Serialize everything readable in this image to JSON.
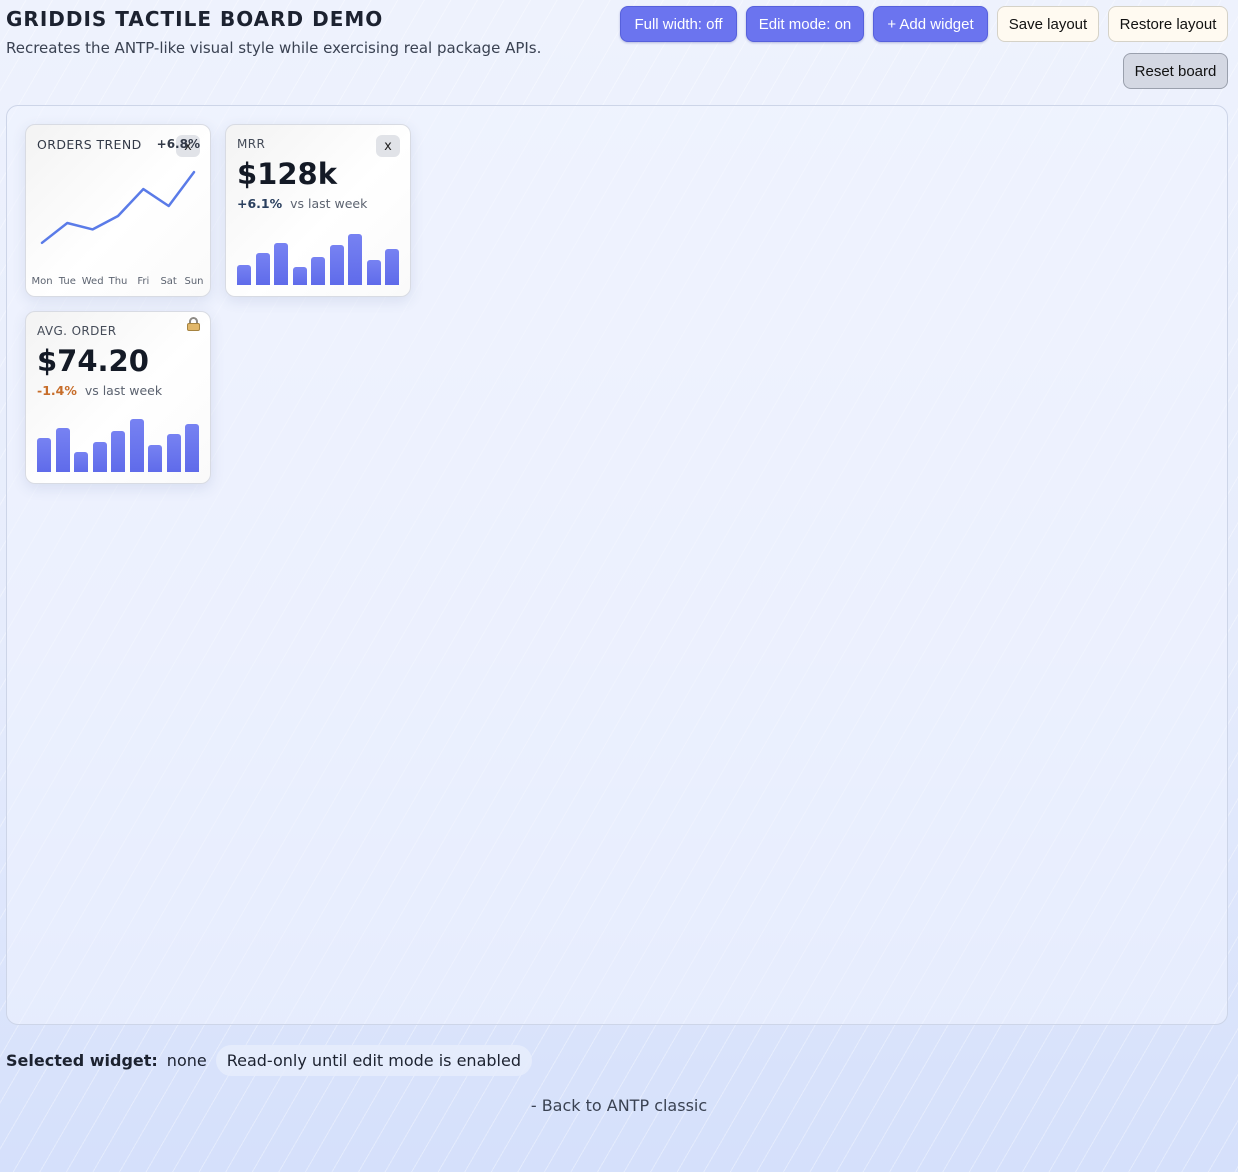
{
  "header": {
    "title": "GRIDDIS TACTILE BOARD DEMO",
    "subtitle": "Recreates the ANTP-like visual style while exercising real package APIs."
  },
  "toolbar": {
    "full_width": "Full width: off",
    "edit_mode": "Edit mode: on",
    "add_widget": "+ Add widget",
    "save_layout": "Save layout",
    "restore_layout": "Restore layout",
    "reset_board": "Reset board"
  },
  "widgets": {
    "orders_trend": {
      "label": "ORDERS TREND",
      "delta": "+6.8%",
      "close": "x",
      "chart_data": {
        "type": "line",
        "categories": [
          "Mon",
          "Tue",
          "Wed",
          "Thu",
          "Fri",
          "Sat",
          "Sun"
        ],
        "values": [
          20,
          48,
          39,
          58,
          96,
          72,
          120
        ],
        "ylim": [
          0,
          130
        ],
        "color": "#5a7be8"
      }
    },
    "mrr": {
      "label": "MRR",
      "value": "$128k",
      "delta": "+6.1%",
      "delta_suffix": "vs last week",
      "close": "x",
      "chart_data": {
        "type": "bar",
        "values": [
          22,
          34,
          45,
          19,
          30,
          43,
          55,
          27,
          39
        ],
        "ylim": [
          0,
          60
        ],
        "color": "#6b74ef"
      }
    },
    "avg_order": {
      "label": "AVG. ORDER",
      "value": "$74.20",
      "delta": "-1.4%",
      "delta_suffix": "vs last week",
      "locked_icon": "lock-icon",
      "chart_data": {
        "type": "bar",
        "values": [
          36,
          47,
          21,
          32,
          44,
          57,
          29,
          41,
          52
        ],
        "ylim": [
          0,
          60
        ],
        "color": "#6b74ef"
      }
    }
  },
  "footer": {
    "selected_label": "Selected widget:",
    "selected_value": "none",
    "status_pill": "Read-only until edit mode is enabled",
    "back_link": "- Back to ANTP classic"
  }
}
